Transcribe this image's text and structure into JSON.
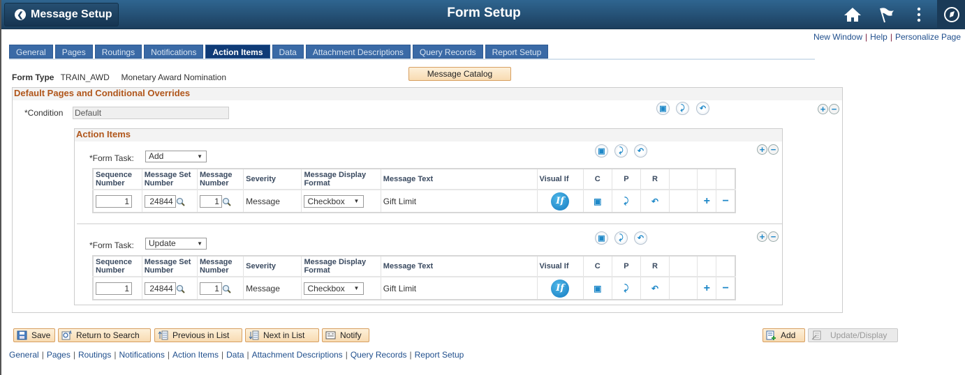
{
  "header": {
    "back_label": "Message Setup",
    "title": "Form Setup",
    "icons": [
      "home-icon",
      "flag-icon",
      "more-options-icon",
      "navbar-compass-icon"
    ]
  },
  "top_links": [
    "New Window",
    "Help",
    "Personalize Page"
  ],
  "tabs": [
    {
      "label": "General",
      "active": false
    },
    {
      "label": "Pages",
      "active": false
    },
    {
      "label": "Routings",
      "active": false
    },
    {
      "label": "Notifications",
      "active": false
    },
    {
      "label": "Action Items",
      "active": true
    },
    {
      "label": "Data",
      "active": false
    },
    {
      "label": "Attachment Descriptions",
      "active": false
    },
    {
      "label": "Query Records",
      "active": false
    },
    {
      "label": "Report Setup",
      "active": false
    }
  ],
  "form_type": {
    "label": "Form Type",
    "code": "TRAIN_AWD",
    "description": "Monetary Award Nomination"
  },
  "message_catalog_label": "Message Catalog",
  "default_section": {
    "title": "Default Pages and Conditional Overrides",
    "condition_label": "*Condition",
    "condition_value": "Default"
  },
  "action_items": {
    "title": "Action Items",
    "columns": [
      "Sequence Number",
      "Message Set Number",
      "Message Number",
      "Severity",
      "Message Display Format",
      "Message Text",
      "Visual If",
      "C",
      "P",
      "R",
      "",
      "",
      ""
    ],
    "form_task_label": "*Form Task:",
    "groups": [
      {
        "form_task": "Add",
        "rows": [
          {
            "sequence": "1",
            "message_set": "24844",
            "message_number": "1",
            "severity": "Message",
            "display_format": "Checkbox",
            "message_text": "Gift Limit",
            "visual_if": "If"
          }
        ]
      },
      {
        "form_task": "Update",
        "rows": [
          {
            "sequence": "1",
            "message_set": "24844",
            "message_number": "1",
            "severity": "Message",
            "display_format": "Checkbox",
            "message_text": "Gift Limit",
            "visual_if": "If"
          }
        ]
      }
    ]
  },
  "toolbar": {
    "save": "Save",
    "return_to_search": "Return to Search",
    "previous_in_list": "Previous in List",
    "next_in_list": "Next in List",
    "notify": "Notify",
    "add": "Add",
    "update_display": "Update/Display"
  },
  "bottom_links": [
    "General",
    "Pages",
    "Routings",
    "Notifications",
    "Action Items",
    "Data",
    "Attachment Descriptions",
    "Query Records",
    "Report Setup"
  ]
}
